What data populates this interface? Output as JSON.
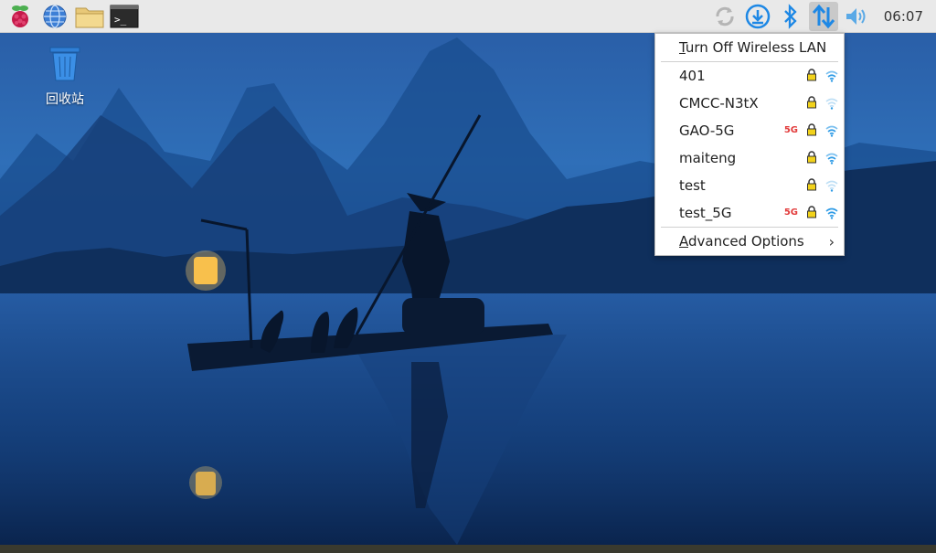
{
  "taskbar": {
    "launchers": [
      {
        "name": "raspberry-menu-icon"
      },
      {
        "name": "web-browser-icon"
      },
      {
        "name": "file-manager-icon"
      },
      {
        "name": "terminal-icon"
      }
    ],
    "tray": [
      {
        "name": "updates-icon"
      },
      {
        "name": "download-icon"
      },
      {
        "name": "bluetooth-icon"
      },
      {
        "name": "network-icon"
      },
      {
        "name": "volume-icon"
      }
    ],
    "clock": "06:07"
  },
  "desktop": {
    "icons": [
      {
        "label": "回收站",
        "icon": "trash-icon"
      }
    ]
  },
  "wifi_menu": {
    "toggle_label_first": "T",
    "toggle_label_rest": "urn Off Wireless LAN",
    "networks": [
      {
        "ssid": "401",
        "band": "",
        "secured": true,
        "strength": "strong"
      },
      {
        "ssid": "CMCC-N3tX",
        "band": "",
        "secured": true,
        "strength": "weak"
      },
      {
        "ssid": "GAO-5G",
        "band": "5G",
        "secured": true,
        "strength": "strong"
      },
      {
        "ssid": "maiteng",
        "band": "",
        "secured": true,
        "strength": "strong"
      },
      {
        "ssid": "test",
        "band": "",
        "secured": true,
        "strength": "weak"
      },
      {
        "ssid": "test_5G",
        "band": "5G",
        "secured": true,
        "strength": "full"
      }
    ],
    "advanced_first": "A",
    "advanced_rest": "dvanced Options",
    "chevron": "›"
  },
  "colors": {
    "taskbar_bg": "#e9e9e9",
    "accent_blue": "#1e88e5",
    "lock_yellow": "#f2d21b",
    "band_red": "#e23b3b"
  }
}
